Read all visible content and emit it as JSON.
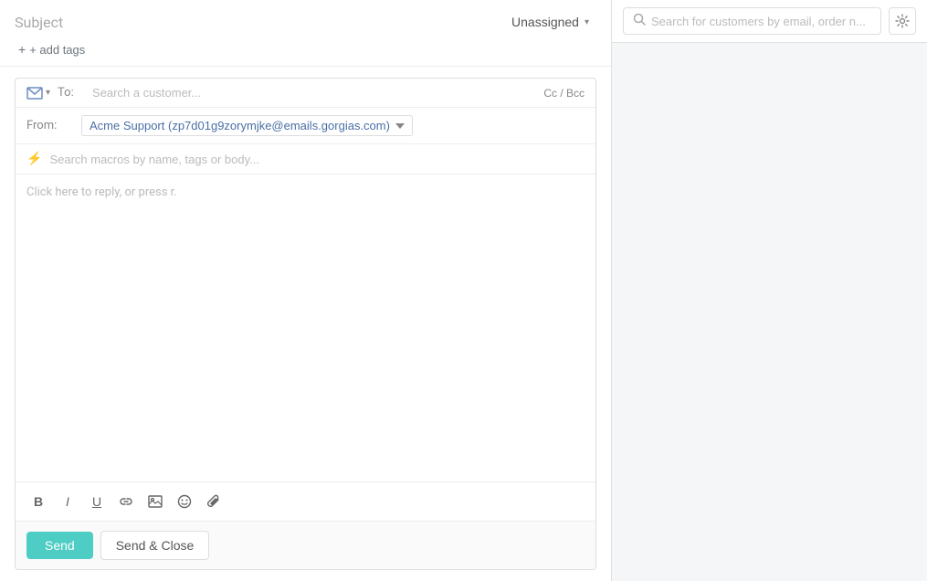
{
  "header": {
    "subject_label": "Subject",
    "add_tags_label": "+ add tags",
    "unassigned_label": "Unassigned"
  },
  "compose": {
    "to_label": "To:",
    "to_placeholder": "Search a customer...",
    "cc_bcc_label": "Cc / Bcc",
    "from_label": "From:",
    "from_value": "Acme Support (zp7d01g9zorymjke@emails.gorgias.com)",
    "macros_placeholder": "Search macros by name, tags or body...",
    "reply_hint": "Click here to reply, or press r."
  },
  "toolbar": {
    "bold": "B",
    "italic": "I",
    "underline": "U",
    "link": "🔗",
    "image": "🖼",
    "emoji": "😊",
    "attach": "📎"
  },
  "actions": {
    "send_label": "Send",
    "send_close_label": "Send & Close"
  },
  "search": {
    "placeholder": "Search for customers by email, order n..."
  }
}
